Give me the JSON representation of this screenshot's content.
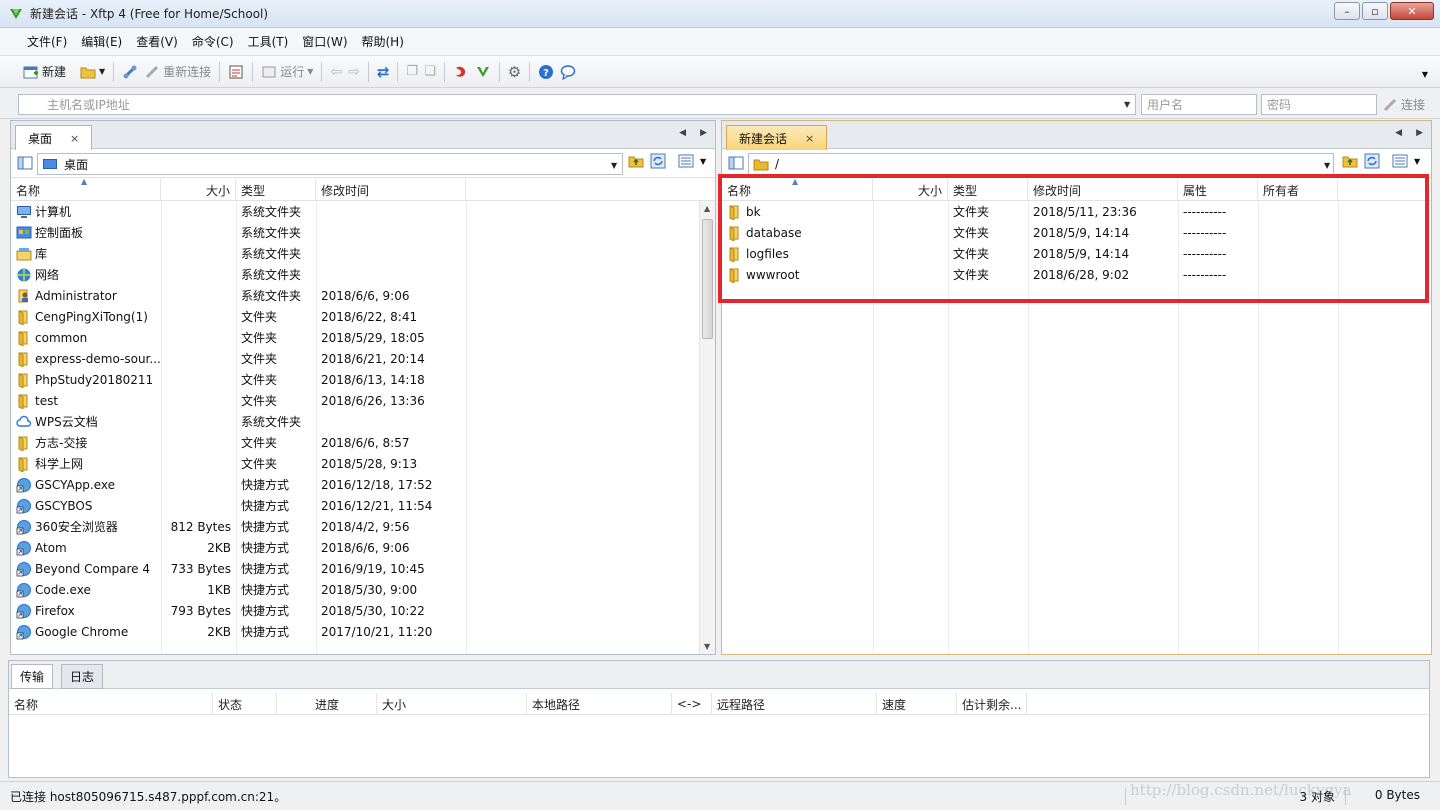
{
  "window": {
    "title": "新建会话 - Xftp 4 (Free for Home/School)",
    "minimize": "–",
    "maximize": "▫",
    "close": "✕"
  },
  "menu": [
    "文件(F)",
    "编辑(E)",
    "查看(V)",
    "命令(C)",
    "工具(T)",
    "窗口(W)",
    "帮助(H)"
  ],
  "toolbar": {
    "new": "新建",
    "reconnect": "重新连接",
    "run": "运行"
  },
  "address": {
    "host_placeholder": "主机名或IP地址",
    "user_placeholder": "用户名",
    "pass_placeholder": "密码",
    "connect": "连接"
  },
  "left": {
    "tab": "桌面",
    "path": "桌面",
    "columns": [
      "名称",
      "大小",
      "类型",
      "修改时间"
    ],
    "rows": [
      {
        "name": "计算机",
        "size": "",
        "type": "系统文件夹",
        "time": "",
        "icon": "computer-icon"
      },
      {
        "name": "控制面板",
        "size": "",
        "type": "系统文件夹",
        "time": "",
        "icon": "control-panel-icon"
      },
      {
        "name": "库",
        "size": "",
        "type": "系统文件夹",
        "time": "",
        "icon": "library-icon"
      },
      {
        "name": "网络",
        "size": "",
        "type": "系统文件夹",
        "time": "",
        "icon": "network-icon"
      },
      {
        "name": "Administrator",
        "size": "",
        "type": "系统文件夹",
        "time": "2018/6/6, 9:06",
        "icon": "user-folder-icon"
      },
      {
        "name": "CengPingXiTong(1)",
        "size": "",
        "type": "文件夹",
        "time": "2018/6/22, 8:41",
        "icon": "folder-icon"
      },
      {
        "name": "common",
        "size": "",
        "type": "文件夹",
        "time": "2018/5/29, 18:05",
        "icon": "folder-icon"
      },
      {
        "name": "express-demo-sour...",
        "size": "",
        "type": "文件夹",
        "time": "2018/6/21, 20:14",
        "icon": "folder-icon"
      },
      {
        "name": "PhpStudy20180211",
        "size": "",
        "type": "文件夹",
        "time": "2018/6/13, 14:18",
        "icon": "folder-icon"
      },
      {
        "name": "test",
        "size": "",
        "type": "文件夹",
        "time": "2018/6/26, 13:36",
        "icon": "folder-icon"
      },
      {
        "name": "WPS云文档",
        "size": "",
        "type": "系统文件夹",
        "time": "",
        "icon": "cloud-icon"
      },
      {
        "name": "方志-交接",
        "size": "",
        "type": "文件夹",
        "time": "2018/6/6, 8:57",
        "icon": "folder-icon"
      },
      {
        "name": "科学上网",
        "size": "",
        "type": "文件夹",
        "time": "2018/5/28, 9:13",
        "icon": "folder-icon"
      },
      {
        "name": "GSCYApp.exe",
        "size": "",
        "type": "快捷方式",
        "time": "2016/12/18, 17:52",
        "icon": "shortcut-icon"
      },
      {
        "name": "GSCYBOS",
        "size": "",
        "type": "快捷方式",
        "time": "2016/12/21, 11:54",
        "icon": "shortcut-icon"
      },
      {
        "name": "360安全浏览器",
        "size": "812 Bytes",
        "type": "快捷方式",
        "time": "2018/4/2, 9:56",
        "icon": "shortcut-icon"
      },
      {
        "name": "Atom",
        "size": "2KB",
        "type": "快捷方式",
        "time": "2018/6/6, 9:06",
        "icon": "shortcut-icon"
      },
      {
        "name": "Beyond Compare 4",
        "size": "733 Bytes",
        "type": "快捷方式",
        "time": "2016/9/19, 10:45",
        "icon": "shortcut-icon"
      },
      {
        "name": "Code.exe",
        "size": "1KB",
        "type": "快捷方式",
        "time": "2018/5/30, 9:00",
        "icon": "shortcut-icon"
      },
      {
        "name": "Firefox",
        "size": "793 Bytes",
        "type": "快捷方式",
        "time": "2018/5/30, 10:22",
        "icon": "shortcut-icon"
      },
      {
        "name": "Google Chrome",
        "size": "2KB",
        "type": "快捷方式",
        "time": "2017/10/21, 11:20",
        "icon": "shortcut-icon"
      }
    ]
  },
  "right": {
    "tab": "新建会话",
    "path": "/",
    "columns": [
      "名称",
      "大小",
      "类型",
      "修改时间",
      "属性",
      "所有者"
    ],
    "rows": [
      {
        "name": "bk",
        "size": "",
        "type": "文件夹",
        "time": "2018/5/11, 23:36",
        "attr": "----------",
        "owner": ""
      },
      {
        "name": "database",
        "size": "",
        "type": "文件夹",
        "time": "2018/5/9, 14:14",
        "attr": "----------",
        "owner": ""
      },
      {
        "name": "logfiles",
        "size": "",
        "type": "文件夹",
        "time": "2018/5/9, 14:14",
        "attr": "----------",
        "owner": ""
      },
      {
        "name": "wwwroot",
        "size": "",
        "type": "文件夹",
        "time": "2018/6/28, 9:02",
        "attr": "----------",
        "owner": ""
      }
    ]
  },
  "bottom": {
    "tabs": [
      "传输",
      "日志"
    ],
    "columns": [
      "名称",
      "状态",
      "进度",
      "大小",
      "本地路径",
      "<->",
      "远程路径",
      "速度",
      "估计剩余..."
    ]
  },
  "status": {
    "text": "已连接 host805096715.s487.pppf.com.cn:21。",
    "objects": "3 对象",
    "bytes": "0 Bytes"
  },
  "watermark": "http://blog.csdn.net/luckygya",
  "colors": {
    "highlight": "#e5262c",
    "folder": "#e8b830",
    "active_tab": "#f9d47a"
  }
}
